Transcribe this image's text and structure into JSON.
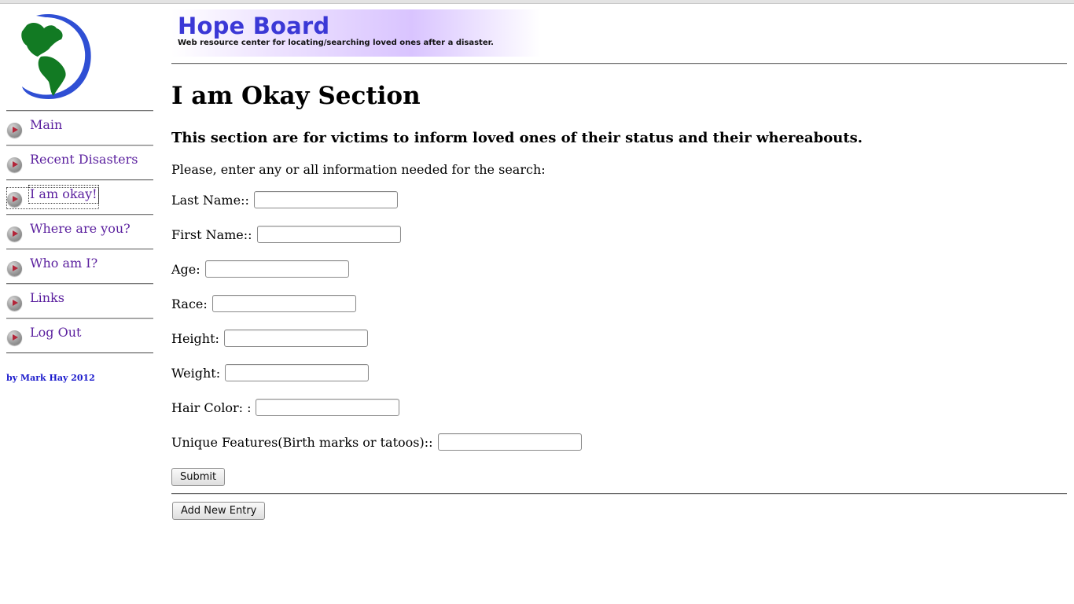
{
  "site": {
    "banner_title": "Hope Board",
    "banner_subtitle": "Web resource center for locating/searching loved ones after a disaster."
  },
  "sidebar": {
    "logo_icon": "globe-logo-icon",
    "items": [
      {
        "label": "Main"
      },
      {
        "label": "Recent Disasters"
      },
      {
        "label": "I am okay!"
      },
      {
        "label": "Where are you?"
      },
      {
        "label": "Who am I?"
      },
      {
        "label": "Links"
      },
      {
        "label": "Log Out"
      }
    ],
    "credit": "by Mark Hay 2012"
  },
  "main": {
    "title": "I am Okay Section",
    "subtitle": "This section are for victims to inform loved ones of their status and their whereabouts.",
    "intro": "Please, enter any or all information needed for the search:",
    "fields": [
      {
        "label": "Last Name::",
        "value": ""
      },
      {
        "label": "First Name::",
        "value": ""
      },
      {
        "label": "Age:",
        "value": ""
      },
      {
        "label": "Race:",
        "value": ""
      },
      {
        "label": "Height:",
        "value": ""
      },
      {
        "label": "Weight:",
        "value": ""
      },
      {
        "label": "Hair Color: :",
        "value": ""
      },
      {
        "label": "Unique Features(Birth marks or tatoos)::",
        "value": ""
      }
    ],
    "submit_label": "Submit",
    "add_entry_label": "Add New Entry"
  },
  "colors": {
    "link": "#5a1f9e",
    "banner_title": "#3b38d6",
    "credit": "#1a1acc"
  }
}
